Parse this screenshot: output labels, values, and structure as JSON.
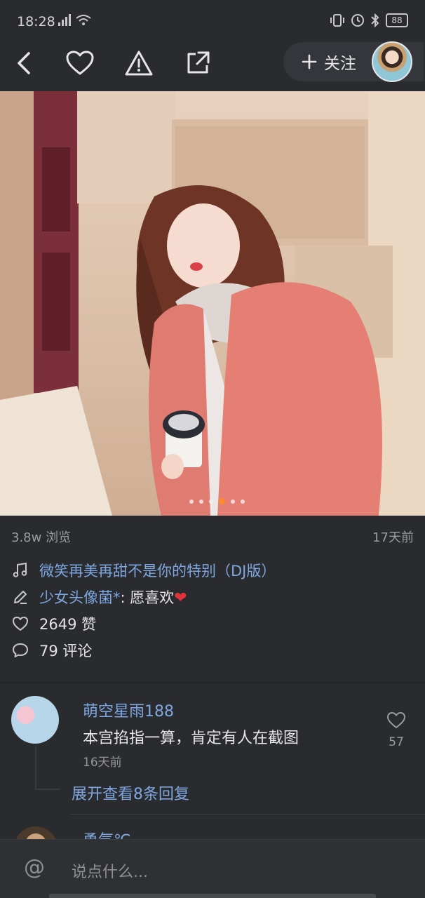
{
  "status_bar": {
    "time": "18:28",
    "battery": "88"
  },
  "toolbar": {
    "follow_label": "关注"
  },
  "photo": {
    "carousel_total": 6,
    "carousel_active": 4
  },
  "post": {
    "views": "3.8w 浏览",
    "date": "17天前",
    "music": "微笑再美再甜不是你的特别（DJ版）",
    "author": "少女头像菌*",
    "caption": ": 愿喜欢",
    "likes": "2649 赞",
    "comments": "79 评论"
  },
  "comments": [
    {
      "user": "萌空星雨188",
      "text": "本宫掐指一算，肯定有人在截图",
      "time": "16天前",
      "likes": "57",
      "expand": "展开查看8条回复"
    },
    {
      "user": "勇气℃"
    }
  ],
  "input": {
    "placeholder": "说点什么..."
  },
  "colors": {
    "background": "#2a2b2f",
    "link": "#7ea7e0",
    "active_dot": "#ff8a2b",
    "heart": "#e0333a"
  }
}
